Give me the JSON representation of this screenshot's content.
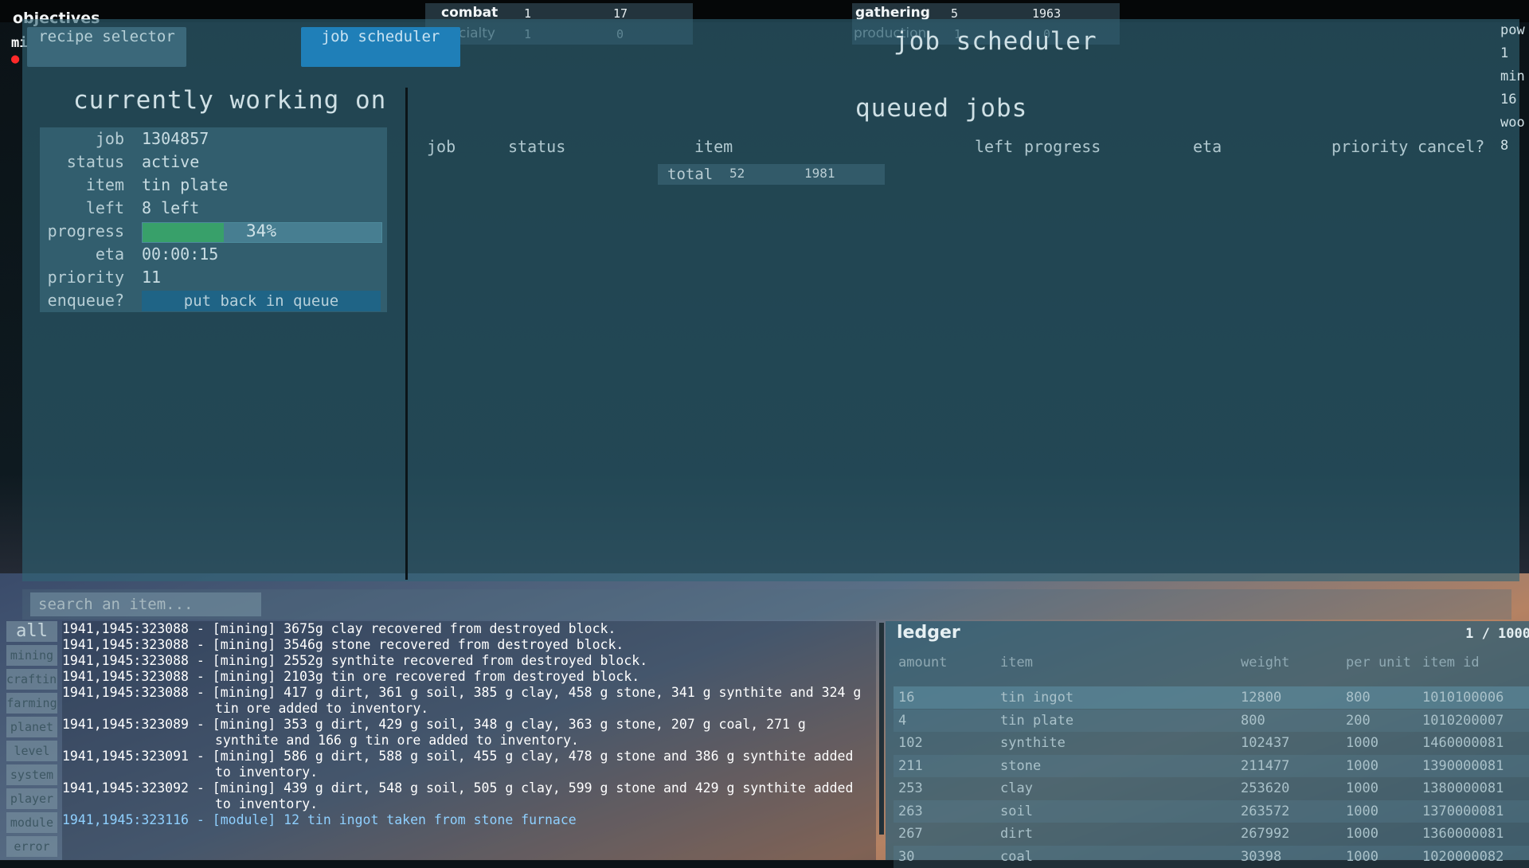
{
  "hud": {
    "objectives_label": "objectives",
    "mi_label": "mi",
    "stats_left": [
      {
        "name": "combat",
        "level": "1",
        "xp": "17"
      },
      {
        "name": "cialty",
        "level": "1",
        "xp": "0"
      }
    ],
    "stats_right": [
      {
        "name": "gathering",
        "level": "5",
        "xp": "1963"
      },
      {
        "name": "production",
        "level": "1",
        "xp": "0"
      }
    ],
    "right_edge": [
      "pow",
      "1",
      "min",
      "16",
      "woo",
      "8"
    ]
  },
  "tabs": [
    {
      "label": "recipe selector",
      "active": false
    },
    {
      "label": "job scheduler",
      "active": true
    }
  ],
  "panel_title": "job scheduler",
  "current": {
    "title": "currently working on",
    "rows": {
      "job": {
        "label": "job",
        "value": "1304857"
      },
      "status": {
        "label": "status",
        "value": "active"
      },
      "item": {
        "label": "item",
        "value": "tin plate"
      },
      "left": {
        "label": "left",
        "value": "8 left"
      },
      "progress": {
        "label": "progress",
        "value": "34%",
        "fraction": 0.34
      },
      "eta": {
        "label": "eta",
        "value": "00:00:15"
      },
      "priority": {
        "label": "priority",
        "value": "11"
      },
      "enqueue": {
        "label": "enqueue?",
        "button": "put back in queue"
      }
    }
  },
  "queue": {
    "title": "queued jobs",
    "columns": [
      "job",
      "status",
      "item",
      "left",
      "progress",
      "eta",
      "priority",
      "cancel?"
    ],
    "total": {
      "label": "total",
      "a": "52",
      "b": "1981"
    }
  },
  "search": {
    "placeholder": "search an item..."
  },
  "log_filters": [
    "all",
    "mining",
    "crafting",
    "farming",
    "planet",
    "level",
    "system",
    "player",
    "module",
    "error"
  ],
  "log": [
    {
      "ts": "1941,1945:323088",
      "text": "[mining] 3675g clay recovered from destroyed block.",
      "type": "mining"
    },
    {
      "ts": "1941,1945:323088",
      "text": "[mining] 3546g stone recovered from destroyed block.",
      "type": "mining"
    },
    {
      "ts": "1941,1945:323088",
      "text": "[mining] 2552g synthite recovered from destroyed block.",
      "type": "mining"
    },
    {
      "ts": "1941,1945:323088",
      "text": "[mining] 2103g tin ore recovered from destroyed block.",
      "type": "mining"
    },
    {
      "ts": "1941,1945:323088",
      "text": "[mining] 417 g dirt, 361 g soil, 385 g clay, 458 g stone, 341 g synthite and 324 g tin ore added to inventory.",
      "type": "mining"
    },
    {
      "ts": "1941,1945:323089",
      "text": "[mining] 353 g dirt, 429 g soil, 348 g clay, 363 g stone, 207 g coal, 271 g synthite and 166 g tin ore added to inventory.",
      "type": "mining"
    },
    {
      "ts": "1941,1945:323091",
      "text": "[mining] 586 g dirt, 588 g soil, 455 g clay, 478 g stone and 386 g synthite added to inventory.",
      "type": "mining"
    },
    {
      "ts": "1941,1945:323092",
      "text": "[mining] 439 g dirt, 548 g soil, 505 g clay, 599 g stone and 429 g synthite added to inventory.",
      "type": "mining"
    },
    {
      "ts": "1941,1945:323116",
      "text": "[module] 12 tin ingot taken from stone furnace",
      "type": "module"
    }
  ],
  "ledger": {
    "title": "ledger",
    "page": "1 / 1000",
    "columns": [
      "amount",
      "item",
      "weight",
      "per unit",
      "item id"
    ],
    "rows": [
      [
        "16",
        "tin ingot",
        "12800",
        "800",
        "1010100006"
      ],
      [
        "4",
        "tin plate",
        "800",
        "200",
        "1010200007"
      ],
      [
        "102",
        "synthite",
        "102437",
        "1000",
        "1460000081"
      ],
      [
        "211",
        "stone",
        "211477",
        "1000",
        "1390000081"
      ],
      [
        "253",
        "clay",
        "253620",
        "1000",
        "1380000081"
      ],
      [
        "263",
        "soil",
        "263572",
        "1000",
        "1370000081"
      ],
      [
        "267",
        "dirt",
        "267992",
        "1000",
        "1360000081"
      ],
      [
        "30",
        "coal",
        "30398",
        "1000",
        "1020000082"
      ]
    ]
  }
}
